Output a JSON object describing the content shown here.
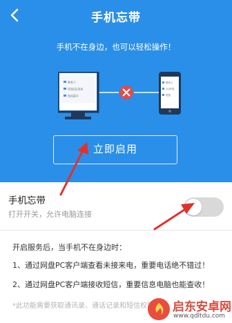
{
  "header": {
    "title": "手机忘带",
    "back_icon": "back-chevron-icon"
  },
  "hero": {
    "subtitle": "手机不在身边，也可以轻松操作！",
    "enable_button": "立即启用",
    "illustration": {
      "pc_screen_lines": [
        "联系人",
        "QQ好友消息",
        "短信提示"
      ],
      "phone_screen_lines": [
        "联系人",
        "QQ好友",
        "短信"
      ],
      "status_icon": "disconnected-x-icon"
    },
    "background_color": "#2a8fe8"
  },
  "setting": {
    "title": "手机忘带",
    "description": "打开开关，允许电脑连接",
    "toggle_state": "off"
  },
  "description": {
    "intro": "开启服务后，当手机不在身边时：",
    "item1": "1、通过网盘PC客户端查看未接来电，重要电话绝不错过！",
    "item2": "2、通过网盘PC客户端接收短信，重要信息电脑也能查收！",
    "note": "*此功能需要获取通讯录、通话记录和短信权限"
  },
  "watermark": {
    "name": "启东安卓网",
    "url": "www.qdltdu.com"
  },
  "annotation_color": "#e0322c"
}
